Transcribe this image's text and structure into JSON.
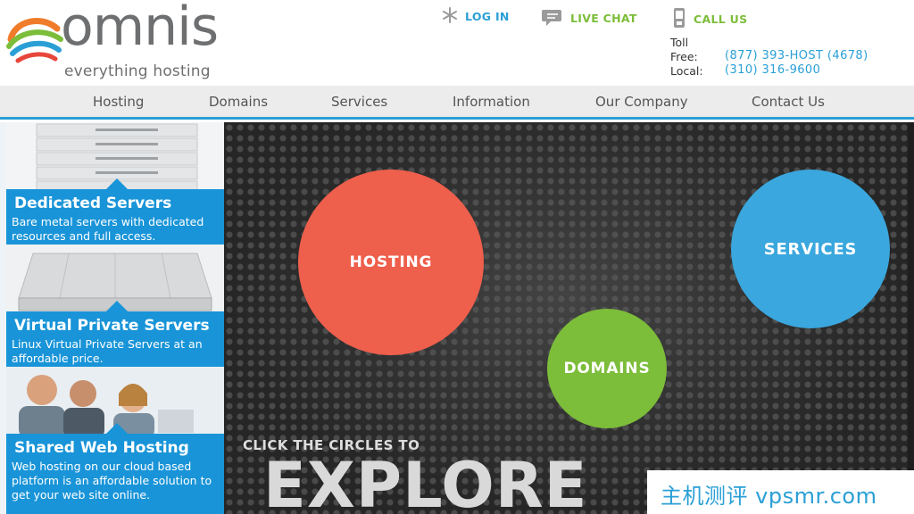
{
  "brand": {
    "name": "omnis",
    "tagline": "everything hosting",
    "colors": {
      "orange": "#f07c2b",
      "green": "#7cbd3a",
      "blue": "#2a9fd6",
      "red": "#e8463b",
      "gray": "#6e6f71"
    }
  },
  "top_links": {
    "login": {
      "label": "LOG IN",
      "icon": "asterisk-icon"
    },
    "chat": {
      "label": "LIVE CHAT",
      "icon": "chat-bubble-icon"
    },
    "call": {
      "label": "CALL US",
      "icon": "phone-icon"
    }
  },
  "phones": {
    "toll_label_1": "Toll",
    "toll_label_2": "Free:",
    "toll_number": "(877) 393-HOST (4678)",
    "local_label": "Local:",
    "local_number": "(310) 316-9600"
  },
  "nav": {
    "items": [
      {
        "label": "Hosting"
      },
      {
        "label": "Domains"
      },
      {
        "label": "Services"
      },
      {
        "label": "Information"
      },
      {
        "label": "Our Company"
      },
      {
        "label": "Contact Us"
      }
    ]
  },
  "sidebar": {
    "cards": [
      {
        "title": "Dedicated Servers",
        "description": "Bare metal servers with dedicated resources and full access."
      },
      {
        "title": "Virtual Private Servers",
        "description": "Linux Virtual Private Servers at an affordable price."
      },
      {
        "title": "Shared Web Hosting",
        "description": "Web hosting on our cloud based platform is an affordable solution to get your web site online."
      }
    ]
  },
  "hero": {
    "circles": {
      "hosting": {
        "label": "HOSTING",
        "color": "#ee5f4c"
      },
      "services": {
        "label": "SERVICES",
        "color": "#3aa7de"
      },
      "domains": {
        "label": "DOMAINS",
        "color": "#7cbd3a"
      }
    },
    "cta_small": "CLICK THE CIRCLES TO",
    "cta_big": "EXPLORE"
  },
  "watermark": {
    "text": "主机测评 vpsmr.com"
  }
}
